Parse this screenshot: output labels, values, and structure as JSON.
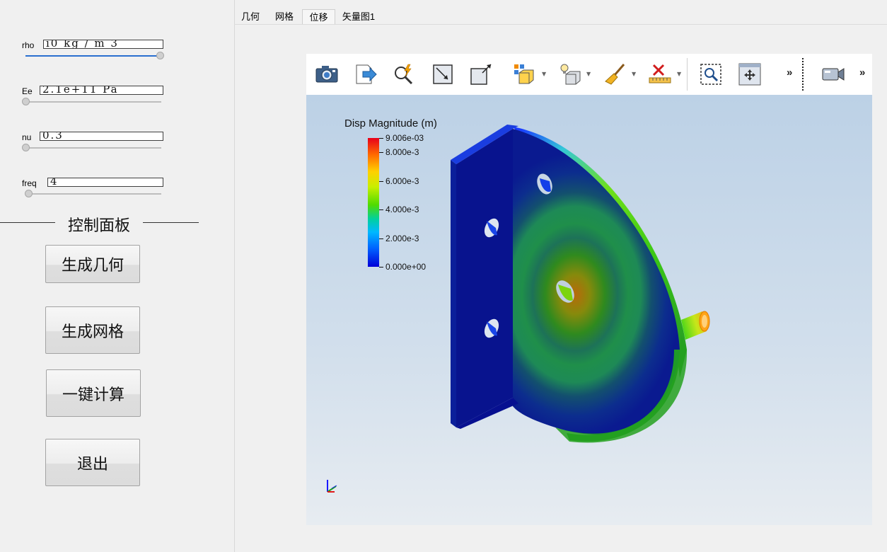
{
  "tabs": [
    "几何",
    "网格",
    "位移",
    "矢量图1"
  ],
  "active_tab": "位移",
  "params": [
    {
      "label": "rho",
      "value": "i0 kg / m 3",
      "slider": 1.0
    },
    {
      "label": "Ee",
      "value": "2.1e+11 Pa",
      "slider": 0.0
    },
    {
      "label": "nu",
      "value": "0.3",
      "slider": 0.0
    },
    {
      "label": "freq",
      "value": "4",
      "slider": 0.0
    }
  ],
  "panel_title": "控制面板",
  "buttons": {
    "geometry": "生成几何",
    "mesh": "生成网格",
    "compute": "一键计算",
    "exit": "退出"
  },
  "toolbar": {
    "icons": [
      "camera-icon",
      "export-icon",
      "interactive-select-icon",
      "reset-view-icon",
      "fit-view-icon",
      "representation-icon",
      "lighting-icon",
      "clear-icon",
      "ruler-delete-icon",
      "zoom-to-box-icon",
      "pan-move-icon",
      "video-camera-icon"
    ],
    "overflow_label": "»"
  },
  "legend": {
    "title": "Disp Magnitude (m)",
    "ticks": [
      "9.006e-03",
      "8.000e-3",
      "6.000e-3",
      "4.000e-3",
      "2.000e-3",
      "0.000e+00"
    ],
    "tick_values": [
      0.009006,
      0.008,
      0.006,
      0.004,
      0.002,
      0.0
    ],
    "max": 0.009006,
    "min": 0.0
  },
  "colors": {
    "panel_bg": "#f0f0f0",
    "slider_fill": "#2a6fcf",
    "viewport_top": "#bcd1e6",
    "viewport_bottom": "#e7ecf1"
  }
}
